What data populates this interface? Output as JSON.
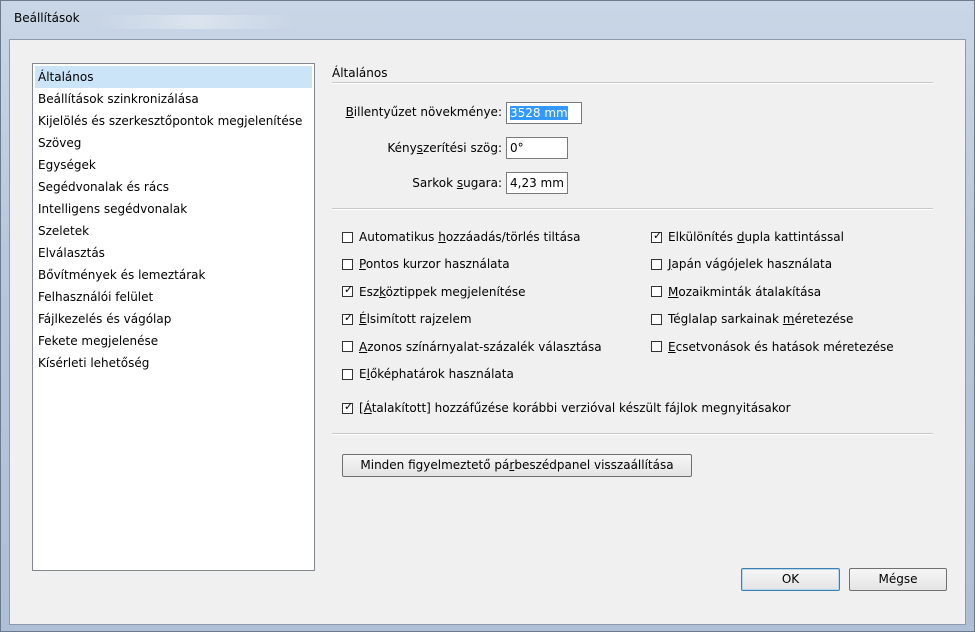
{
  "window": {
    "title": "Beállítások"
  },
  "sidebar": {
    "items": [
      {
        "label": "Általános",
        "selected": true
      },
      {
        "label": "Beállítások szinkronizálása"
      },
      {
        "label": "Kijelölés és szerkesztőpontok megjelenítése"
      },
      {
        "label": "Szöveg"
      },
      {
        "label": "Egységek"
      },
      {
        "label": "Segédvonalak és rács"
      },
      {
        "label": "Intelligens segédvonalak"
      },
      {
        "label": "Szeletek"
      },
      {
        "label": "Elválasztás"
      },
      {
        "label": "Bővítmények és lemeztárak"
      },
      {
        "label": "Felhasználói felület"
      },
      {
        "label": "Fájlkezelés és vágólap"
      },
      {
        "label": "Fekete megjelenése"
      },
      {
        "label": "Kísérleti lehetőség"
      }
    ]
  },
  "main": {
    "section_title": "Általános",
    "fields": {
      "keyboard_increment": {
        "label_pre": "",
        "label_u": "B",
        "label_post": "illentyűzet növekménye:",
        "value": "3528 mm"
      },
      "constrain_angle": {
        "label_pre": "Kény",
        "label_u": "s",
        "label_post": "zerítési szög:",
        "value": "0°"
      },
      "corner_radius": {
        "label_pre": "Sarkok ",
        "label_u": "s",
        "label_post": "ugara:",
        "value": "4,23 mm"
      }
    },
    "checkboxes_left": [
      {
        "pre": "Automatikus ",
        "u": "h",
        "post": "ozzáadás/törlés tiltása",
        "checked": false
      },
      {
        "pre": "",
        "u": "P",
        "post": "ontos kurzor használata",
        "checked": false
      },
      {
        "pre": "Esz",
        "u": "k",
        "post": "öztippek megjelenítése",
        "checked": true
      },
      {
        "pre": "",
        "u": "É",
        "post": "lsimított rajzelem",
        "checked": true
      },
      {
        "pre": "",
        "u": "A",
        "post": "zonos színárnyalat-százalék választása",
        "checked": false
      },
      {
        "pre": "E",
        "u": "l",
        "post": "őképhatárok használata",
        "checked": false
      }
    ],
    "checkboxes_right": [
      {
        "pre": "Elkülönítés ",
        "u": "d",
        "post": "upla kattintással",
        "checked": true
      },
      {
        "pre": "",
        "u": "J",
        "post": "apán vágójelek használata",
        "checked": false
      },
      {
        "pre": "",
        "u": "M",
        "post": "ozaikminták átalakítása",
        "checked": false
      },
      {
        "pre": "Téglalap sarkainak ",
        "u": "m",
        "post": "éretezése",
        "checked": false
      },
      {
        "pre": "",
        "u": "E",
        "post": "csetvonások és hatások méretezése",
        "checked": false
      }
    ],
    "append_transformed": {
      "pre": "[",
      "u": "Á",
      "post": "talakított] hozzáfűzése korábbi verzióval készült fájlok megnyitásakor",
      "checked": true
    },
    "reset_button": {
      "pre": "Minden figyelmeztető pá",
      "u": "r",
      "post": "beszédpanel visszaállítása"
    }
  },
  "buttons": {
    "ok": "OK",
    "cancel": "Mégse"
  },
  "icons": {
    "check": "check-mark-icon"
  }
}
